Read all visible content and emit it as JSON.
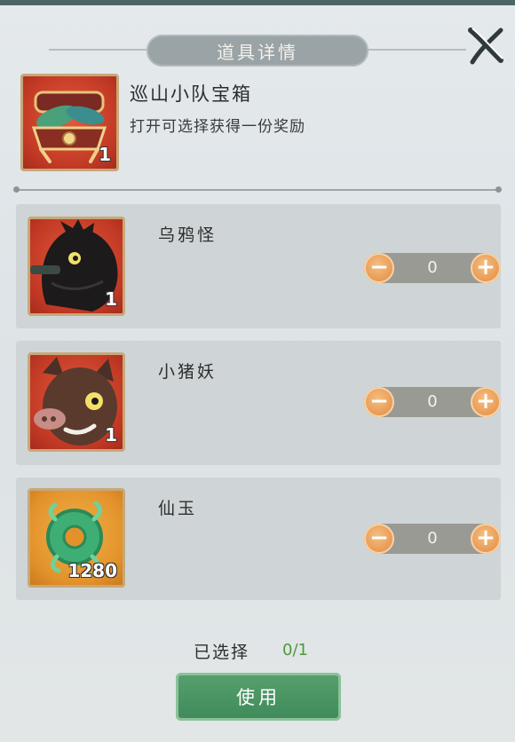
{
  "dialog": {
    "title": "道具详情",
    "close_icon": "close-brush-x-icon"
  },
  "chest": {
    "name": "巡山小队宝箱",
    "description": "打开可选择获得一份奖励",
    "count": "1",
    "icon": "treasure-chest-icon"
  },
  "rewards": [
    {
      "name": "乌鸦怪",
      "count": "1",
      "selected": "0",
      "icon": "crow-monster-icon"
    },
    {
      "name": "小猪妖",
      "count": "1",
      "selected": "0",
      "icon": "boar-demon-icon"
    },
    {
      "name": "仙玉",
      "count": "1280",
      "selected": "0",
      "icon": "jade-coin-icon"
    }
  ],
  "stepper": {
    "minus": "−",
    "plus": "+"
  },
  "footer": {
    "selected_label": "已选择",
    "selected_value": "0/1",
    "use_button": "使用"
  },
  "colors": {
    "accent_orange": "#e8964f",
    "confirm_green": "#3e8a58",
    "selected_green": "#4e9a3a"
  }
}
